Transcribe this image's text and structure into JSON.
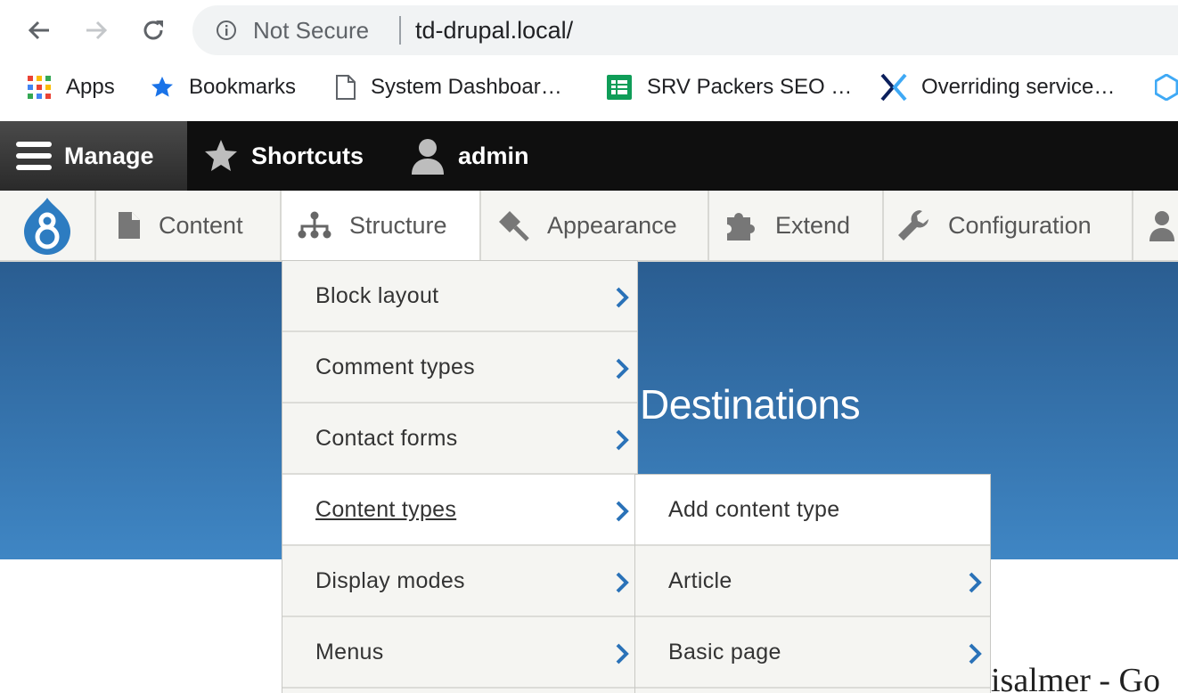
{
  "browser": {
    "security_label": "Not Secure",
    "url": "td-drupal.local/",
    "bookmarks": [
      {
        "label": "Apps",
        "icon": "apps-grid-icon"
      },
      {
        "label": "Bookmarks",
        "icon": "star-icon"
      },
      {
        "label": "System Dashboar…",
        "icon": "document-icon"
      },
      {
        "label": "SRV Packers SEO …",
        "icon": "spreadsheet-icon"
      },
      {
        "label": "Overriding service…",
        "icon": "x-logo-icon"
      }
    ]
  },
  "toolbar": {
    "manage": "Manage",
    "shortcuts": "Shortcuts",
    "user": "admin"
  },
  "tray": {
    "items": [
      {
        "label": "Content",
        "icon": "file-icon"
      },
      {
        "label": "Structure",
        "icon": "structure-icon"
      },
      {
        "label": "Appearance",
        "icon": "paintbrush-icon"
      },
      {
        "label": "Extend",
        "icon": "puzzle-icon"
      },
      {
        "label": "Configuration",
        "icon": "wrench-icon"
      }
    ]
  },
  "page": {
    "hero_title": "Destinations",
    "content_snippet": "isalmer - Go"
  },
  "structure_menu": {
    "items": [
      {
        "label": "Block layout"
      },
      {
        "label": "Comment types"
      },
      {
        "label": "Contact forms"
      },
      {
        "label": "Content types"
      },
      {
        "label": "Display modes"
      },
      {
        "label": "Menus"
      }
    ]
  },
  "content_types_menu": {
    "items": [
      {
        "label": "Add content type"
      },
      {
        "label": "Article"
      },
      {
        "label": "Basic page"
      }
    ]
  },
  "colors": {
    "toolbar_bg": "#0f0f0f",
    "hero_top": "#2a5d91",
    "hero_bottom": "#3f86c4",
    "chevron": "#2a72b8"
  }
}
